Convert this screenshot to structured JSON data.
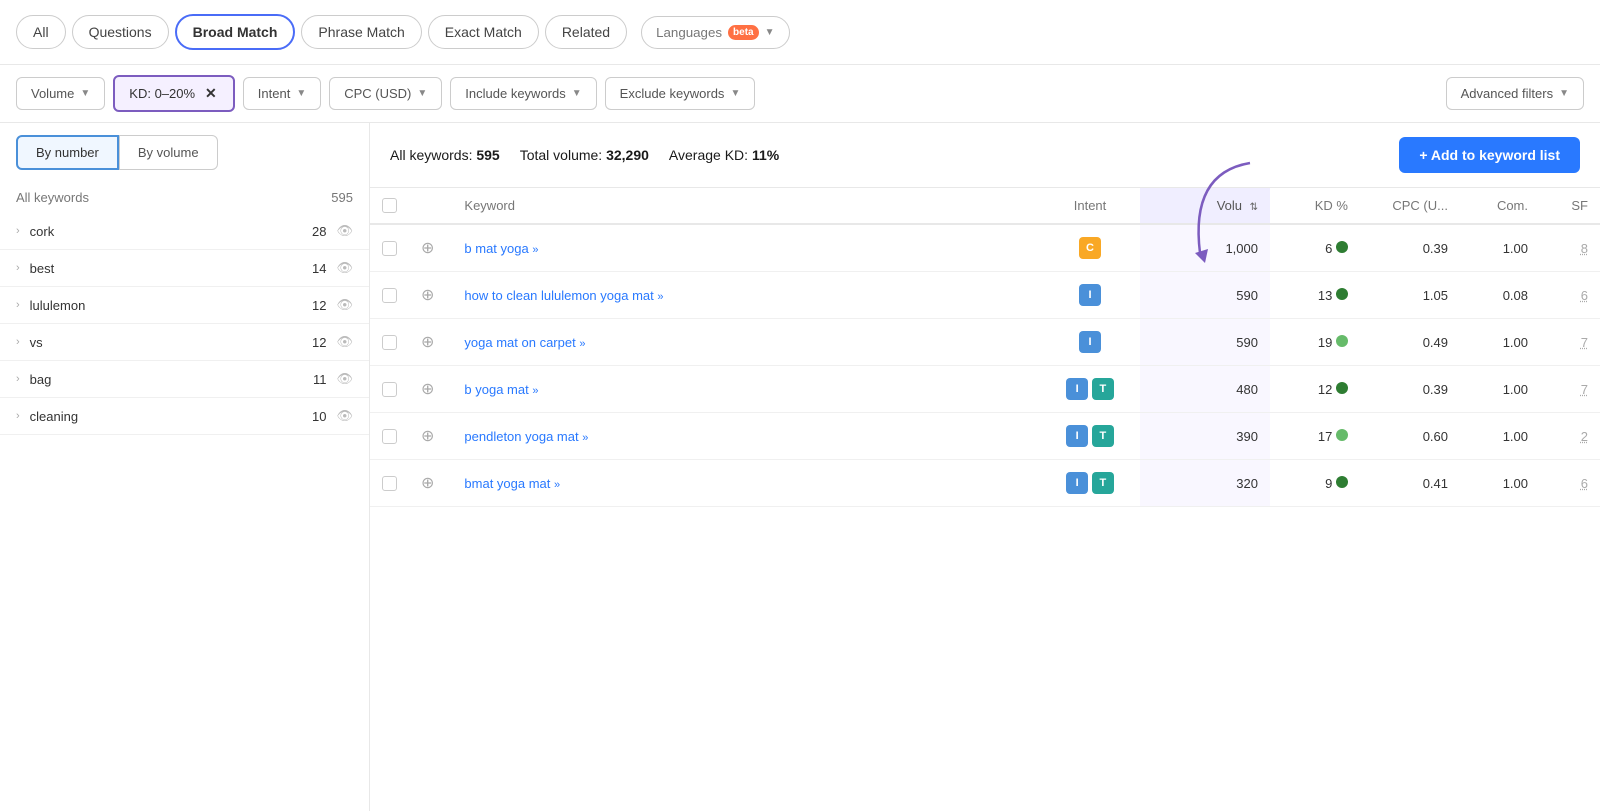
{
  "tabs": {
    "items": [
      "All",
      "Questions",
      "Broad Match",
      "Phrase Match",
      "Exact Match",
      "Related"
    ],
    "active": "Broad Match",
    "languages": "Languages",
    "languages_beta": "beta"
  },
  "filters": {
    "volume": "Volume",
    "kd": "KD: 0–20%",
    "intent": "Intent",
    "cpc": "CPC (USD)",
    "include": "Include keywords",
    "exclude": "Exclude keywords",
    "advanced": "Advanced filters"
  },
  "sidebar": {
    "tab1": "By number",
    "tab2": "By volume",
    "header_keyword": "All keywords",
    "header_count": "595",
    "items": [
      {
        "keyword": "cork",
        "count": "28"
      },
      {
        "keyword": "best",
        "count": "14"
      },
      {
        "keyword": "lululemon",
        "count": "12"
      },
      {
        "keyword": "vs",
        "count": "12"
      },
      {
        "keyword": "bag",
        "count": "11"
      },
      {
        "keyword": "cleaning",
        "count": "10"
      }
    ]
  },
  "content": {
    "all_keywords_label": "All keywords:",
    "all_keywords_val": "595",
    "total_volume_label": "Total volume:",
    "total_volume_val": "32,290",
    "avg_kd_label": "Average KD:",
    "avg_kd_val": "11%",
    "add_btn": "+ Add to keyword list"
  },
  "table": {
    "cols": [
      "",
      "",
      "Keyword",
      "Intent",
      "Volu",
      "KD %",
      "CPC (U...",
      "Com.",
      "SF"
    ],
    "rows": [
      {
        "keyword": "b mat yoga",
        "intents": [
          "C"
        ],
        "volume": "1,000",
        "kd": "6",
        "kd_color": "dark",
        "cpc": "0.39",
        "com": "1.00",
        "sf": "8"
      },
      {
        "keyword": "how to clean lululemon yoga mat",
        "intents": [
          "I"
        ],
        "volume": "590",
        "kd": "13",
        "kd_color": "dark",
        "cpc": "1.05",
        "com": "0.08",
        "sf": "6"
      },
      {
        "keyword": "yoga mat on carpet",
        "intents": [
          "I"
        ],
        "volume": "590",
        "kd": "19",
        "kd_color": "light",
        "cpc": "0.49",
        "com": "1.00",
        "sf": "7"
      },
      {
        "keyword": "b yoga mat",
        "intents": [
          "I",
          "T"
        ],
        "volume": "480",
        "kd": "12",
        "kd_color": "dark",
        "cpc": "0.39",
        "com": "1.00",
        "sf": "7"
      },
      {
        "keyword": "pendleton yoga mat",
        "intents": [
          "I",
          "T"
        ],
        "volume": "390",
        "kd": "17",
        "kd_color": "light",
        "cpc": "0.60",
        "com": "1.00",
        "sf": "2"
      },
      {
        "keyword": "bmat yoga mat",
        "intents": [
          "I",
          "T"
        ],
        "volume": "320",
        "kd": "9",
        "kd_color": "dark",
        "cpc": "0.41",
        "com": "1.00",
        "sf": "6"
      }
    ]
  }
}
